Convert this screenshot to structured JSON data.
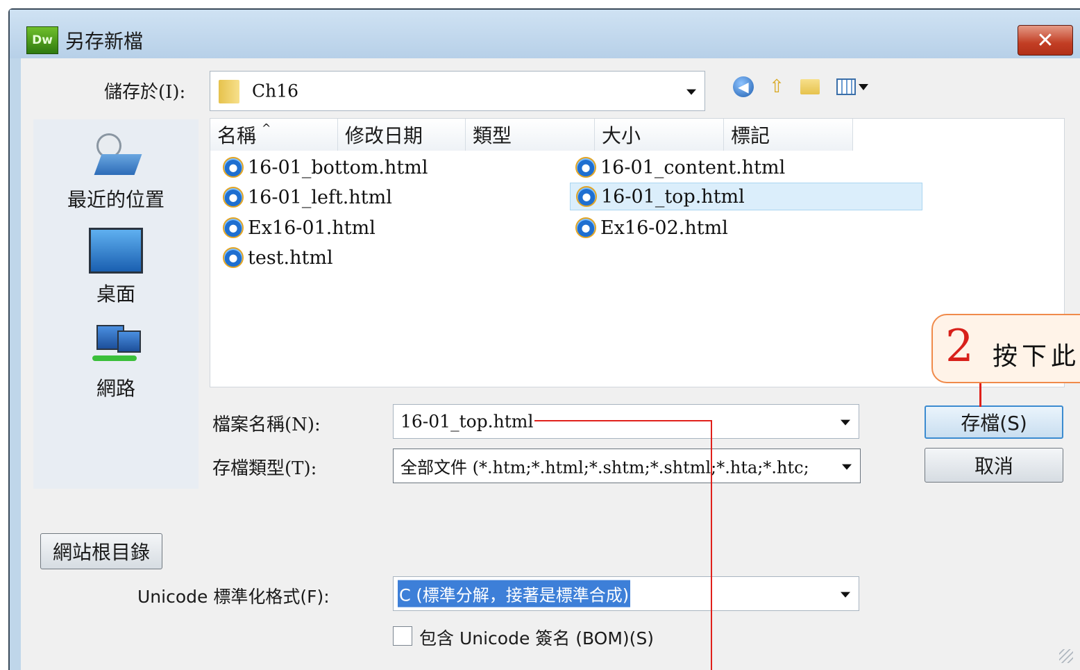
{
  "window": {
    "title": "另存新檔",
    "app_icon_text": "Dw"
  },
  "save_in": {
    "label": "儲存於(I):",
    "value": "Ch16"
  },
  "places": [
    {
      "label": "最近的位置",
      "icon": "recent-places-icon"
    },
    {
      "label": "桌面",
      "icon": "desktop-icon"
    },
    {
      "label": "網路",
      "icon": "network-icon"
    }
  ],
  "columns": [
    "名稱",
    "修改日期",
    "類型",
    "大小",
    "標記"
  ],
  "files_left": [
    "16-01_bottom.html",
    "16-01_left.html",
    "Ex16-01.html",
    "test.html"
  ],
  "files_right": [
    "16-01_content.html",
    "16-01_top.html",
    "Ex16-02.html"
  ],
  "filename": {
    "label": "檔案名稱(N):",
    "value": "16-01_top.html"
  },
  "filetype": {
    "label": "存檔類型(T):",
    "value": "全部文件 (*.htm;*.html;*.shtm;*.shtml;*.hta;*.htc;"
  },
  "buttons": {
    "save": "存檔(S)",
    "cancel": "取消",
    "site_root": "網站根目錄"
  },
  "unicode": {
    "label": "Unicode 標準化格式(F):",
    "value": "C (標準分解，接著是標準合成)"
  },
  "bom": {
    "label": "包含 Unicode 簽名 (BOM)(S)",
    "checked": false
  },
  "callout": {
    "number": "2",
    "text": "按下此"
  }
}
